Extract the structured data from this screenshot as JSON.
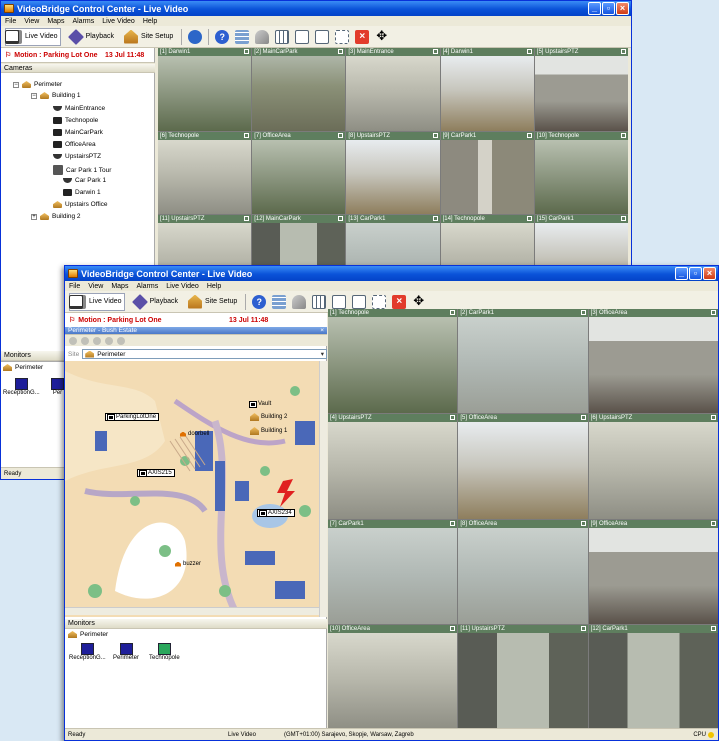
{
  "colors": {
    "titlebar": "#0a52d8",
    "alarm": "#cc0000",
    "selection": "#f0e000",
    "tilelabel": "#5e7e5e"
  },
  "back": {
    "title": "VideoBridge Control Center - Live Video",
    "menu": [
      "File",
      "View",
      "Maps",
      "Alarms",
      "Live Video",
      "Help"
    ],
    "toolbar": {
      "live_video": "Live Video",
      "playback": "Playback",
      "site_setup": "Site Setup"
    },
    "alarm": {
      "text": "Motion : Parking Lot One",
      "time": "13 Jul 11:48"
    },
    "cameras_header": "Cameras",
    "tree": [
      "Perimeter",
      "Building 1",
      "MainEntrance",
      "Technopole",
      "MainCarPark",
      "OfficeArea",
      "UpstairsPTZ",
      "Car Park 1 Tour",
      "Car Park 1",
      "Darwin 1",
      "Upstairs Office",
      "Building 2"
    ],
    "monitors_header": "Monitors",
    "monitors_perimeter": "Perimeter",
    "monitors": [
      "ReceptionG...",
      "Per"
    ],
    "status": "Ready",
    "tiles": [
      "[1] Darwin1",
      "[2] MainCarPark",
      "[3] MainEntrance",
      "[4] Darwin1",
      "[5] UpstairsPTZ",
      "[6] Technopole",
      "[7] OfficeArea",
      "[8] UpstairsPTZ",
      "[9] CarPark1",
      "[10] Technopole",
      "[11] UpstairsPTZ",
      "[12] MainCarPark",
      "[13] CarPark1",
      "[14] Technopole",
      "[15] CarPark1"
    ]
  },
  "front": {
    "title": "VideoBridge Control Center - Live Video",
    "menu": [
      "File",
      "View",
      "Maps",
      "Alarms",
      "Live Video",
      "Help"
    ],
    "toolbar": {
      "live_video": "Live Video",
      "playback": "Playback",
      "site_setup": "Site Setup"
    },
    "alarm": {
      "text": "Motion : Parking Lot One",
      "time": "13 Jul 11:48"
    },
    "map_header": "Perimeter - Bush Estate",
    "site_label": "Site",
    "site_value": "Perimeter",
    "map_labels": {
      "parking": "ParkingLotOne",
      "vault": "Vault",
      "b2": "Building 2",
      "b1": "Building 1",
      "door": "doorbell",
      "cam1": "AXIS215",
      "cam2": "AXIS234",
      "buzzer": "buzzer"
    },
    "monitors_header": "Monitors",
    "monitors_perimeter": "Perimeter",
    "monitors": [
      "ReceptionG...",
      "Perimeter",
      "Technopole"
    ],
    "status": {
      "left": "Ready",
      "mode": "Live Video",
      "tz": "(GMT+01:00) Sarajevo, Skopje, Warsaw, Zagreb",
      "cpu": "CPU"
    },
    "tiles": [
      "[1] Technopole",
      "[2] CarPark1",
      "[3] OfficeArea",
      "[4] UpstairsPTZ",
      "[5] OfficeArea",
      "[6] UpstairsPTZ",
      "[7] CarPark1",
      "[8] OfficeArea",
      "[9] OfficeArea",
      "[10] OfficeArea",
      "[11] UpstairsPTZ",
      "[12] CarPark1"
    ]
  }
}
